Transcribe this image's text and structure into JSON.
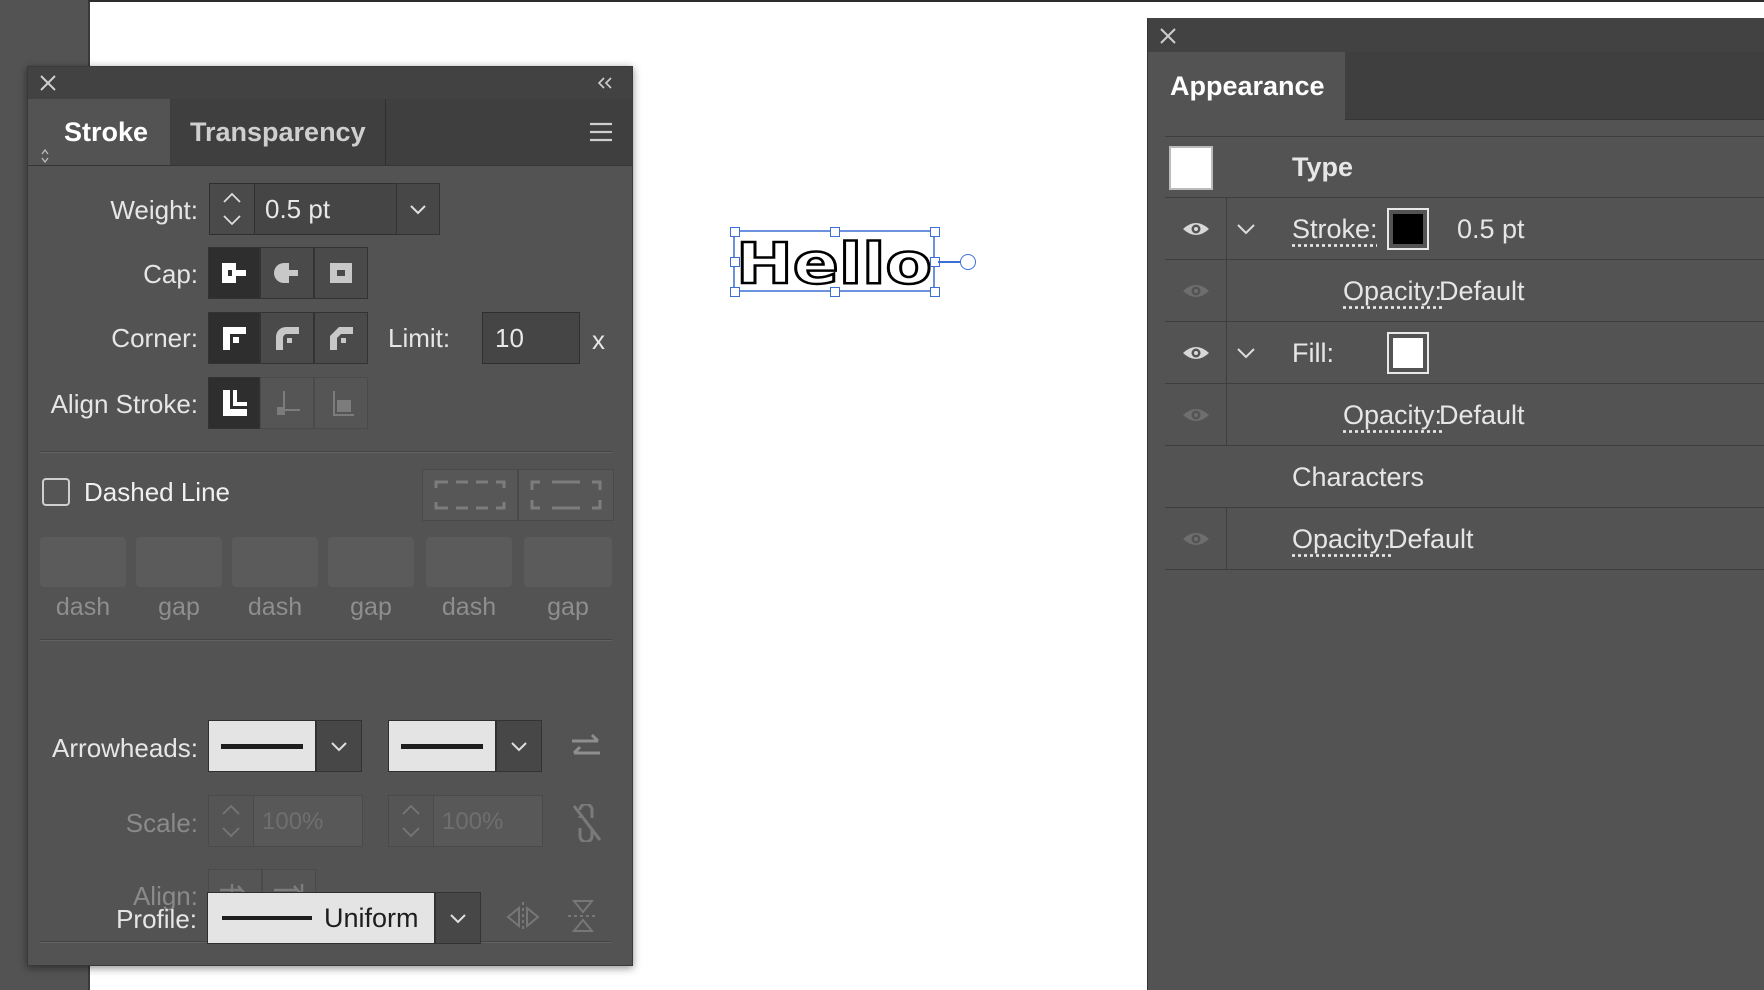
{
  "stroke_panel": {
    "close_icon": "close-icon",
    "collapse_icon": "double-chevron-left-icon",
    "tabs": [
      {
        "label": "Stroke"
      },
      {
        "label": "Transparency"
      }
    ],
    "menu_icon": "hamburger-menu-icon",
    "weight": {
      "label": "Weight:",
      "value": "0.5 pt"
    },
    "cap": {
      "label": "Cap:",
      "selected": "butt"
    },
    "corner": {
      "label": "Corner:",
      "selected": "miter",
      "limit_label": "Limit:",
      "limit_value": "10",
      "limit_suffix": "x"
    },
    "align_stroke": {
      "label": "Align Stroke:",
      "selected": "center"
    },
    "dashed": {
      "label": "Dashed Line",
      "checked": false,
      "fields": [
        "dash",
        "gap",
        "dash",
        "gap",
        "dash",
        "gap"
      ]
    },
    "arrowheads": {
      "label": "Arrowheads:"
    },
    "scale": {
      "label": "Scale:",
      "start": "100%",
      "end": "100%"
    },
    "align": {
      "label": "Align:"
    },
    "profile": {
      "label": "Profile:",
      "value": "Uniform"
    }
  },
  "canvas": {
    "text_object": "Hello",
    "selection_color": "#3b6fd4"
  },
  "appearance_panel": {
    "close_icon": "close-icon",
    "tab": "Appearance",
    "type_label": "Type",
    "stroke": {
      "label": "Stroke:",
      "value": "0.5 pt",
      "swatch": "#000000"
    },
    "stroke_opacity": {
      "label": "Opacity:",
      "value": "Default"
    },
    "fill": {
      "label": "Fill:",
      "swatch": "#ffffff"
    },
    "fill_opacity": {
      "label": "Opacity:",
      "value": "Default"
    },
    "characters_label": "Characters",
    "opacity": {
      "label": "Opacity:",
      "value": "Default"
    }
  }
}
